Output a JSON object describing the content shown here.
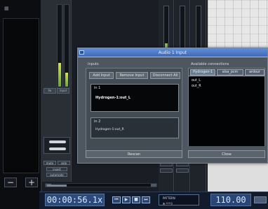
{
  "dialog": {
    "title": "Audio 1 Input",
    "sections": {
      "inputs": "Inputs",
      "available": "Available connections"
    },
    "buttons": {
      "add_input": "Add Input",
      "remove_input": "Remove Input",
      "disconnect_all": "Disconnect All",
      "rescan": "Rescan",
      "close": "Close"
    },
    "input_cards": [
      {
        "label": "in 1",
        "value": "Hydrogen-1:out_L"
      },
      {
        "label": "in 2",
        "value": "Hydrogen-1:out_R"
      }
    ],
    "tabs": [
      {
        "label": "Hydrogen-1"
      },
      {
        "label": "alsa_pcm"
      },
      {
        "label": "ardour"
      }
    ],
    "ports": [
      {
        "label": "out_L"
      },
      {
        "label": "out_R"
      }
    ]
  },
  "transport": {
    "time": "00:00:56.1x",
    "pattern_label": "PATTERN",
    "pattern_sub": "▲ song",
    "tempo": "110.00",
    "buttons": [
      "⏮",
      "▶",
      "■",
      "⏭"
    ]
  },
  "mixer": {
    "labels": [
      "fw",
      "input"
    ],
    "mini_buttons": [
      "mute",
      "solo",
      "insert",
      "automate"
    ]
  },
  "left_panel": {
    "top_icon": "tracks-icon",
    "minus": "−",
    "plus": "+"
  }
}
